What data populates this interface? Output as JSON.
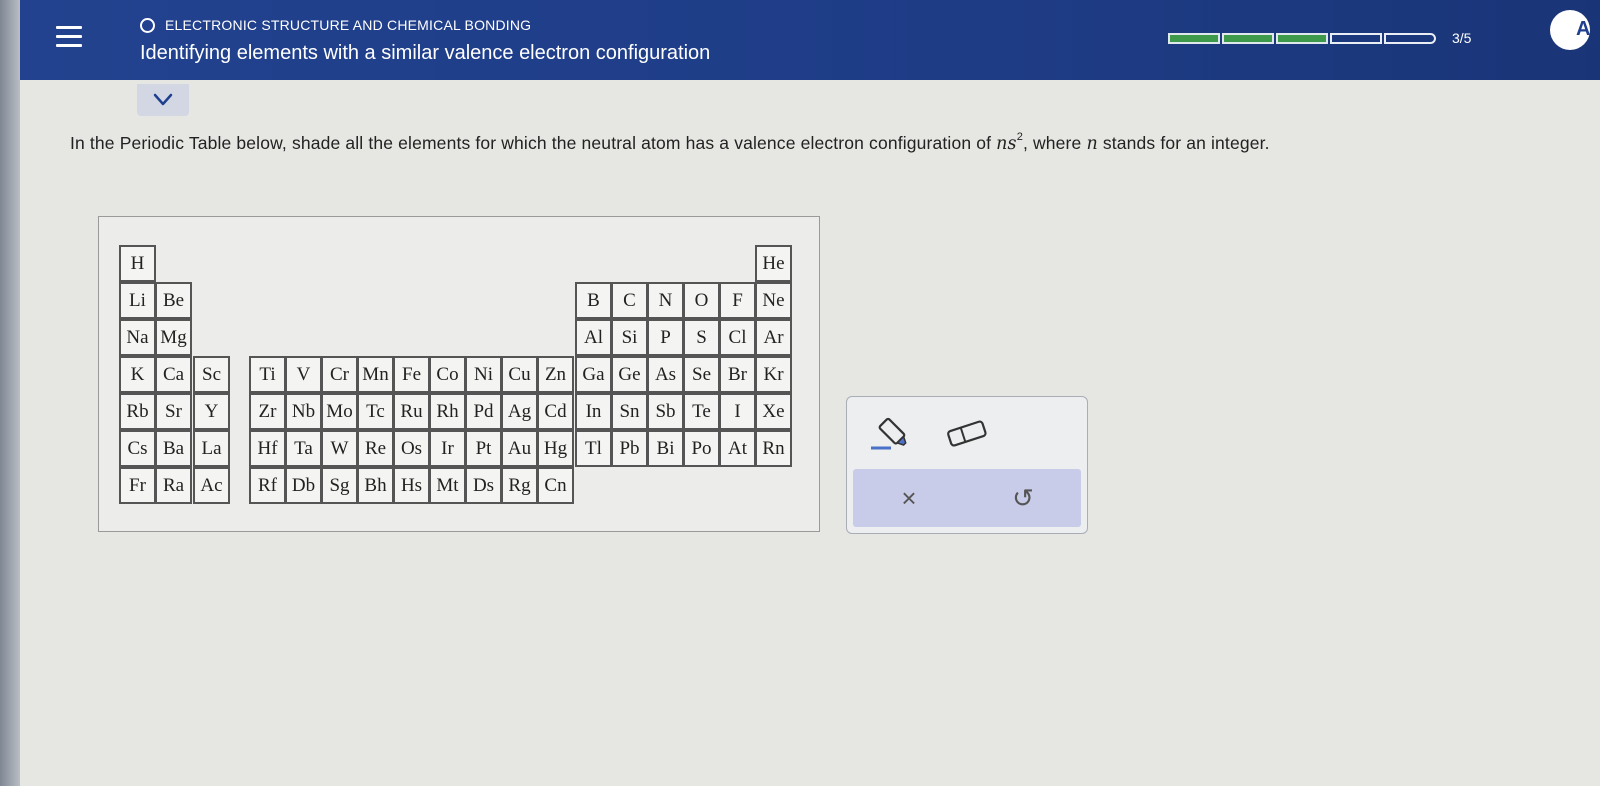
{
  "header": {
    "section": "ELECTRONIC STRUCTURE AND CHEMICAL BONDING",
    "title": "Identifying elements with a similar valence electron configuration",
    "progress": {
      "completed": 3,
      "total": 5,
      "label": "3/5"
    },
    "avatar_initial": "A"
  },
  "question": {
    "text_before": "In the Periodic Table below, shade all the elements for which the neutral atom has a valence electron configuration of ",
    "config_base": "ns",
    "config_exp": "2",
    "text_middle": ", where ",
    "variable": "n",
    "text_after": " stands for an integer."
  },
  "periodic_table": {
    "elements": [
      {
        "s": "H",
        "r": 0,
        "c": 0
      },
      {
        "s": "He",
        "r": 0,
        "c": 18
      },
      {
        "s": "Li",
        "r": 1,
        "c": 0
      },
      {
        "s": "Be",
        "r": 1,
        "c": 1
      },
      {
        "s": "B",
        "r": 1,
        "c": 13
      },
      {
        "s": "C",
        "r": 1,
        "c": 14
      },
      {
        "s": "N",
        "r": 1,
        "c": 15
      },
      {
        "s": "O",
        "r": 1,
        "c": 16
      },
      {
        "s": "F",
        "r": 1,
        "c": 17
      },
      {
        "s": "Ne",
        "r": 1,
        "c": 18
      },
      {
        "s": "Na",
        "r": 2,
        "c": 0
      },
      {
        "s": "Mg",
        "r": 2,
        "c": 1
      },
      {
        "s": "Al",
        "r": 2,
        "c": 13
      },
      {
        "s": "Si",
        "r": 2,
        "c": 14
      },
      {
        "s": "P",
        "r": 2,
        "c": 15
      },
      {
        "s": "S",
        "r": 2,
        "c": 16
      },
      {
        "s": "Cl",
        "r": 2,
        "c": 17
      },
      {
        "s": "Ar",
        "r": 2,
        "c": 18
      },
      {
        "s": "K",
        "r": 3,
        "c": 0
      },
      {
        "s": "Ca",
        "r": 3,
        "c": 1
      },
      {
        "s": "Sc",
        "r": 3,
        "c": 2
      },
      {
        "s": "Ti",
        "r": 3,
        "c": 3
      },
      {
        "s": "V",
        "r": 3,
        "c": 4
      },
      {
        "s": "Cr",
        "r": 3,
        "c": 5
      },
      {
        "s": "Mn",
        "r": 3,
        "c": 6
      },
      {
        "s": "Fe",
        "r": 3,
        "c": 7
      },
      {
        "s": "Co",
        "r": 3,
        "c": 8
      },
      {
        "s": "Ni",
        "r": 3,
        "c": 9
      },
      {
        "s": "Cu",
        "r": 3,
        "c": 10
      },
      {
        "s": "Zn",
        "r": 3,
        "c": 11
      },
      {
        "s": "Ga",
        "r": 3,
        "c": 12
      },
      {
        "s": "Ge",
        "r": 3,
        "c": 13
      },
      {
        "s": "As",
        "r": 3,
        "c": 14
      },
      {
        "s": "Se",
        "r": 3,
        "c": 15
      },
      {
        "s": "Br",
        "r": 3,
        "c": 16
      },
      {
        "s": "Kr",
        "r": 3,
        "c": 18
      },
      {
        "s": "Rb",
        "r": 4,
        "c": 0
      },
      {
        "s": "Sr",
        "r": 4,
        "c": 1
      },
      {
        "s": "Y",
        "r": 4,
        "c": 2
      },
      {
        "s": "Zr",
        "r": 4,
        "c": 3
      },
      {
        "s": "Nb",
        "r": 4,
        "c": 4
      },
      {
        "s": "Mo",
        "r": 4,
        "c": 5
      },
      {
        "s": "Tc",
        "r": 4,
        "c": 6
      },
      {
        "s": "Ru",
        "r": 4,
        "c": 7
      },
      {
        "s": "Rh",
        "r": 4,
        "c": 8
      },
      {
        "s": "Pd",
        "r": 4,
        "c": 9
      },
      {
        "s": "Ag",
        "r": 4,
        "c": 10
      },
      {
        "s": "Cd",
        "r": 4,
        "c": 11
      },
      {
        "s": "In",
        "r": 4,
        "c": 12
      },
      {
        "s": "Sn",
        "r": 4,
        "c": 13
      },
      {
        "s": "Sb",
        "r": 4,
        "c": 14
      },
      {
        "s": "Te",
        "r": 4,
        "c": 15
      },
      {
        "s": "I",
        "r": 4,
        "c": 16
      },
      {
        "s": "Xe",
        "r": 4,
        "c": 18
      },
      {
        "s": "Cs",
        "r": 5,
        "c": 0
      },
      {
        "s": "Ba",
        "r": 5,
        "c": 1
      },
      {
        "s": "La",
        "r": 5,
        "c": 2
      },
      {
        "s": "Hf",
        "r": 5,
        "c": 3
      },
      {
        "s": "Ta",
        "r": 5,
        "c": 4
      },
      {
        "s": "W",
        "r": 5,
        "c": 5
      },
      {
        "s": "Re",
        "r": 5,
        "c": 6
      },
      {
        "s": "Os",
        "r": 5,
        "c": 7
      },
      {
        "s": "Ir",
        "r": 5,
        "c": 8
      },
      {
        "s": "Pt",
        "r": 5,
        "c": 9
      },
      {
        "s": "Au",
        "r": 5,
        "c": 10
      },
      {
        "s": "Hg",
        "r": 5,
        "c": 11
      },
      {
        "s": "Tl",
        "r": 5,
        "c": 12
      },
      {
        "s": "Pb",
        "r": 5,
        "c": 13
      },
      {
        "s": "Bi",
        "r": 5,
        "c": 14
      },
      {
        "s": "Po",
        "r": 5,
        "c": 15
      },
      {
        "s": "At",
        "r": 5,
        "c": 16
      },
      {
        "s": "Rn",
        "r": 5,
        "c": 18
      },
      {
        "s": "Fr",
        "r": 6,
        "c": 0
      },
      {
        "s": "Ra",
        "r": 6,
        "c": 1
      },
      {
        "s": "Ac",
        "r": 6,
        "c": 2
      },
      {
        "s": "Rf",
        "r": 6,
        "c": 3
      },
      {
        "s": "Db",
        "r": 6,
        "c": 4
      },
      {
        "s": "Sg",
        "r": 6,
        "c": 5
      },
      {
        "s": "Bh",
        "r": 6,
        "c": 6
      },
      {
        "s": "Hs",
        "r": 6,
        "c": 7
      },
      {
        "s": "Mt",
        "r": 6,
        "c": 8
      },
      {
        "s": "Ds",
        "r": 6,
        "c": 9
      },
      {
        "s": "Rg",
        "r": 6,
        "c": 10
      },
      {
        "s": "Cn",
        "r": 6,
        "c": 11
      }
    ]
  },
  "tools": {
    "items": [
      {
        "name": "highlighter-icon"
      },
      {
        "name": "eraser-icon"
      }
    ],
    "actions": {
      "clear_symbol": "×",
      "undo_symbol": "↺"
    }
  },
  "colors": {
    "header_bg": "#1f3f8f",
    "progress_done": "#3d9a4a",
    "actions_bg": "#c9cce9"
  }
}
